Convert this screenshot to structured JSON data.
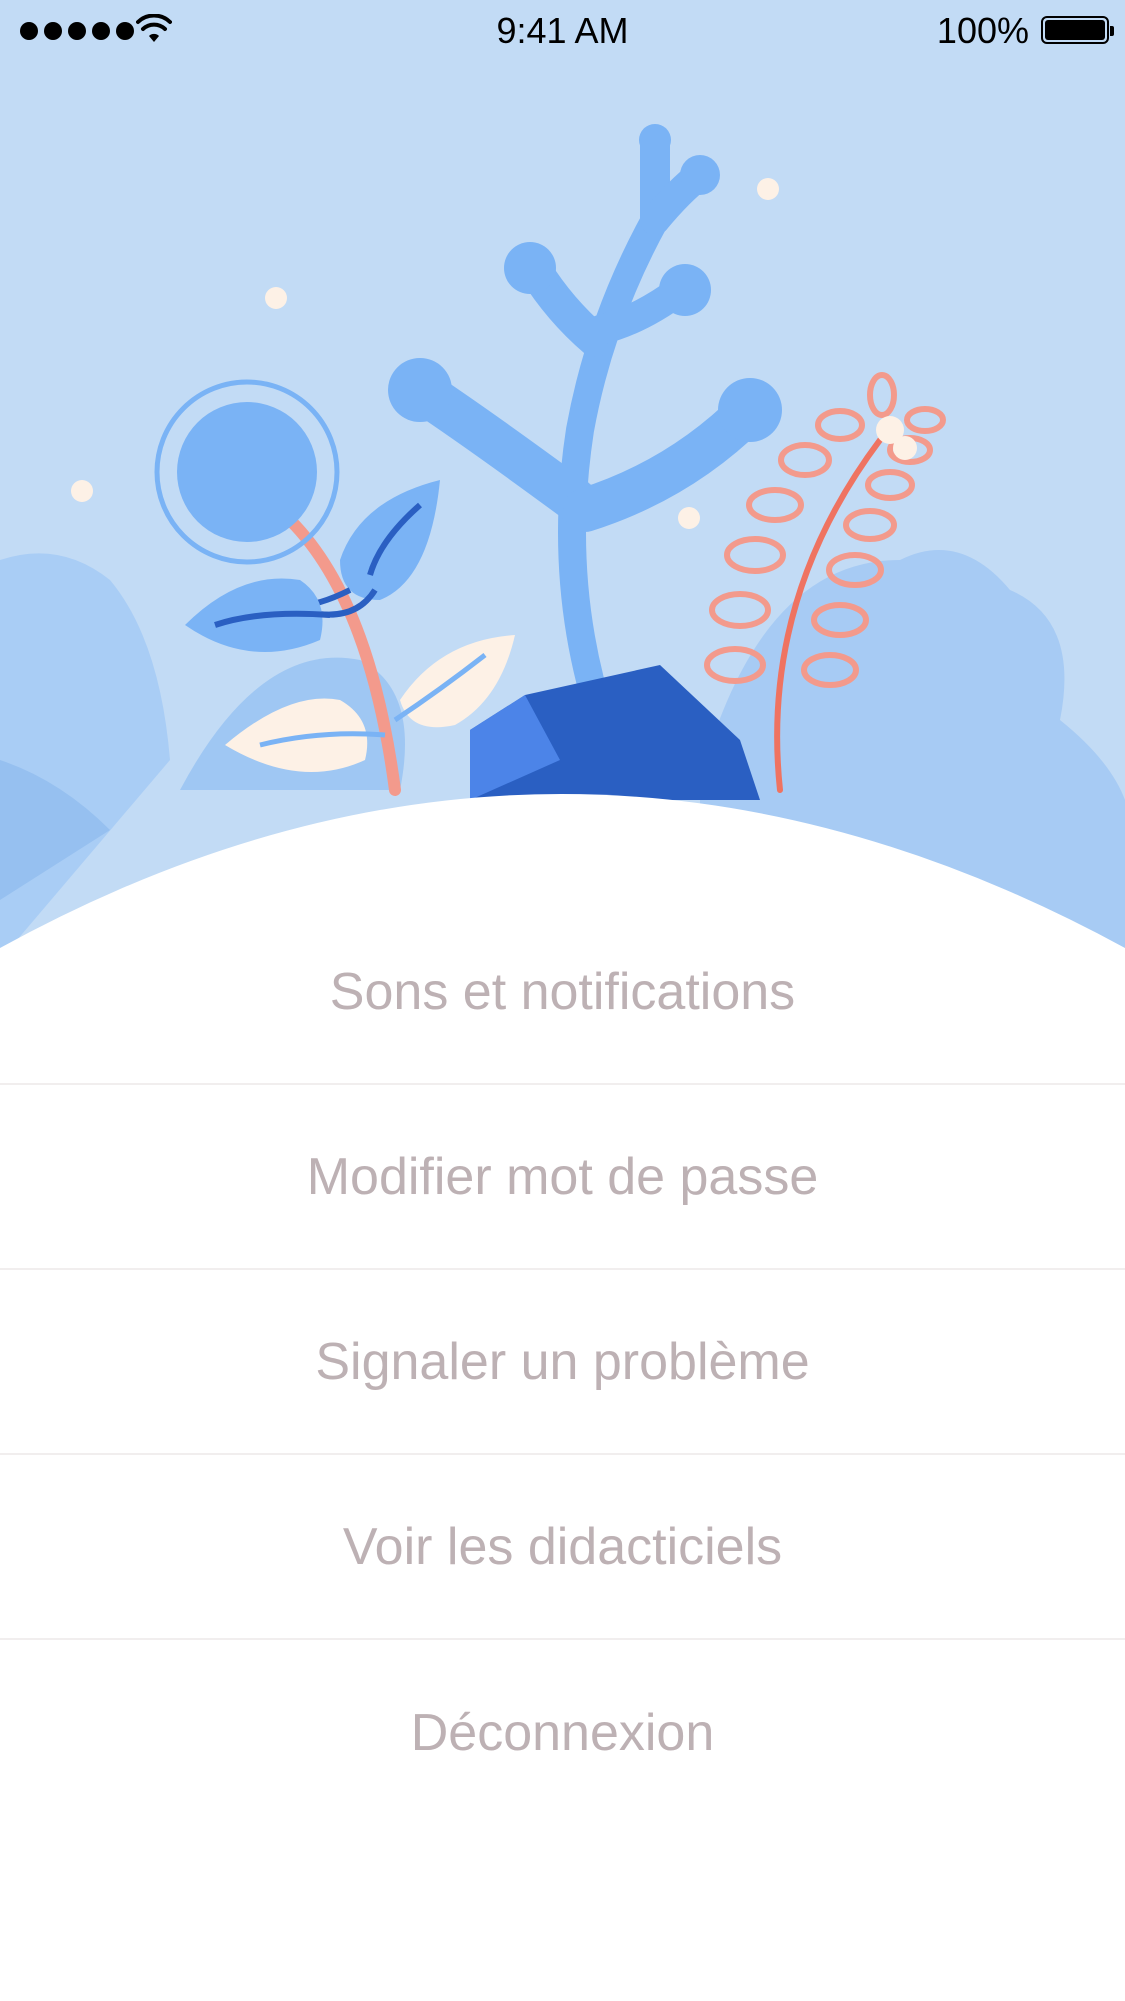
{
  "status_bar": {
    "time": "9:41 AM",
    "battery_percent": "100%",
    "battery_level": 1.0,
    "signal_bars": 5,
    "wifi_icon": "wifi-icon"
  },
  "hero": {
    "illustration": "plants-illustration",
    "colors": {
      "sky": "#c2dbf5",
      "plant_blue": "#7ab3f5",
      "plant_dark_blue": "#2a5fc2",
      "coral": "#f39a8c",
      "cream": "#fdf1e6"
    }
  },
  "menu": {
    "text_color": "#bdb1b4",
    "items": [
      {
        "label": "Sons et notifications"
      },
      {
        "label": "Modifier mot de passe"
      },
      {
        "label": "Signaler un problème"
      },
      {
        "label": "Voir les didacticiels"
      },
      {
        "label": "Déconnexion"
      }
    ]
  }
}
